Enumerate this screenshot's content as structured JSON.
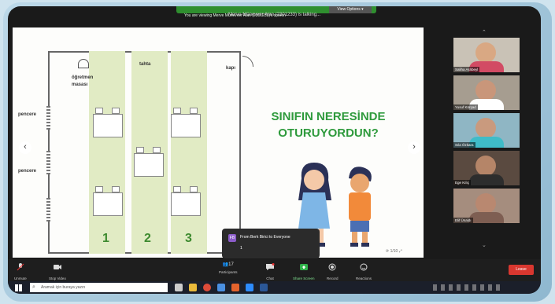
{
  "banner": {
    "text": "You are viewing Merve Münevver Alan (2301233)'s screen",
    "view_options": "View Options ▾"
  },
  "share_title": "Merve Münevver Alan (2301233) is talking...",
  "slide": {
    "labels": {
      "board": "tahta",
      "door": "kapı",
      "teacher_desk_line1": "öğretmen",
      "teacher_desk_line2": "masası",
      "window_top": "pencere",
      "window_bottom": "pencere"
    },
    "columns": [
      "1",
      "2",
      "3"
    ],
    "question_line1": "SINIFIN NERESİNDE",
    "question_line2": "OTURUYORDUN?",
    "accent_color": "#2e9a3c",
    "column_color": "#e1ebc4",
    "controls": "1/10"
  },
  "chat": {
    "avatar": "FB",
    "from": "From Berk Birici to Everyone",
    "message": "1"
  },
  "gallery": [
    {
      "name": "Saliha Aslıbeyl",
      "bg": "#c9c2b6",
      "skin": "#d9a883",
      "shirt": "#d24b64"
    },
    {
      "name": "Yusuf Kürşad",
      "bg": "#a69d90",
      "skin": "#c9967a",
      "shirt": "#ffffff"
    },
    {
      "name": "Sıla Özkara",
      "bg": "#8fb6c4",
      "skin": "#c99a7e",
      "shirt": "#3fbcc8"
    },
    {
      "name": "Ege Kılıç",
      "bg": "#5a4a40",
      "skin": "#b58568",
      "shirt": "#2d2d2d"
    },
    {
      "name": "Elif Ünaldı",
      "bg": "#a58d7e",
      "skin": "#b98870",
      "shirt": "#7e5e52"
    }
  ],
  "toolbar": {
    "unmute": "Unmute",
    "stop_video": "Stop Video",
    "participants": "Participants",
    "participant_count": "17",
    "chat": "Chat",
    "share_screen": "Share Screen",
    "record": "Record",
    "reactions": "Reactions",
    "end": "Leave"
  },
  "taskbar": {
    "search_placeholder": "Aramak için buraya yazın"
  }
}
